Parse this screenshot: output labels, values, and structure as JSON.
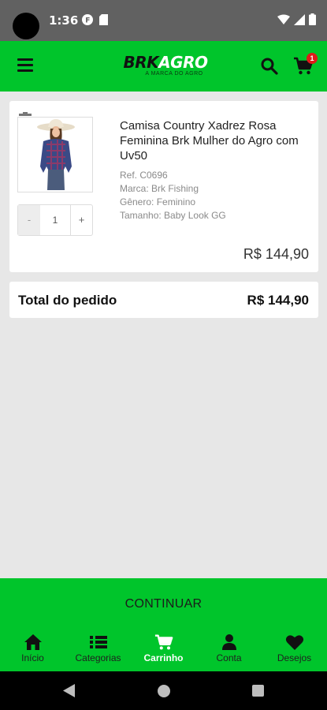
{
  "status_bar": {
    "time": "1:36"
  },
  "header": {
    "logo_main_1": "BRK",
    "logo_main_2": "AGRO",
    "logo_sub": "A MARCA DO AGRO",
    "cart_count": "1"
  },
  "cart_item": {
    "name": "Camisa Country Xadrez Rosa Feminina Brk Mulher do Agro com Uv50",
    "ref": "Ref. C0696",
    "brand": "Marca: Brk Fishing",
    "gender": "Gênero: Feminino",
    "size": "Tamanho: Baby Look GG",
    "quantity": "1",
    "minus_label": "-",
    "plus_label": "+",
    "price": "R$ 144,90"
  },
  "total": {
    "label": "Total do pedido",
    "value": "R$ 144,90"
  },
  "continue_label": "CONTINUAR",
  "bottom_nav": {
    "items": [
      {
        "label": "Início",
        "icon": "home-icon"
      },
      {
        "label": "Categorias",
        "icon": "list-icon"
      },
      {
        "label": "Carrinho",
        "icon": "cart-icon"
      },
      {
        "label": "Conta",
        "icon": "user-icon"
      },
      {
        "label": "Desejos",
        "icon": "heart-icon"
      }
    ],
    "active_index": 2
  },
  "colors": {
    "brand_green": "#00c52b",
    "status_bar": "#616161",
    "background": "#e7e7e7",
    "badge_red": "#e01a1a"
  }
}
